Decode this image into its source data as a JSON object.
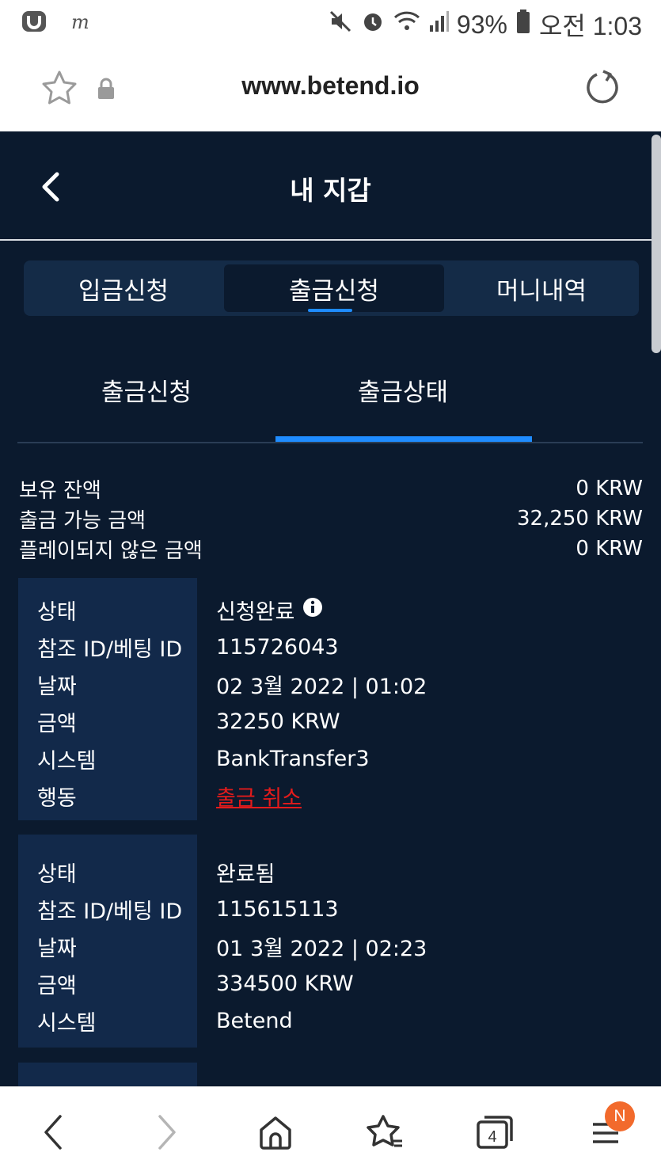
{
  "statusbar": {
    "battery": "93%",
    "time": "오전 1:03"
  },
  "browser": {
    "url": "www.betend.io"
  },
  "header": {
    "title": "내 지갑"
  },
  "tabs": [
    "입금신청",
    "출금신청",
    "머니내역"
  ],
  "subtabs": [
    "출금신청",
    "출금상태"
  ],
  "balance": [
    {
      "label": "보유 잔액",
      "value": "0 KRW"
    },
    {
      "label": "출금 가능 금액",
      "value": "32,250 KRW"
    },
    {
      "label": "플레이되지 않은 금액",
      "value": "0 KRW"
    }
  ],
  "records": [
    {
      "labels": [
        "상태",
        "참조 ID/베팅 ID",
        "날짜",
        "금액",
        "시스템",
        "행동"
      ],
      "status": "신청완료",
      "ref_id": "115726043",
      "date": "02 3월 2022 | 01:02",
      "amount": "32250 KRW",
      "system": "BankTransfer3",
      "action": "출금 취소"
    },
    {
      "labels": [
        "상태",
        "참조 ID/베팅 ID",
        "날짜",
        "금액",
        "시스템"
      ],
      "status": "완료됨",
      "ref_id": "115615113",
      "date": "01 3월 2022 | 02:23",
      "amount": "334500 KRW",
      "system": "Betend"
    }
  ],
  "bottomnav": {
    "tabs_count": "4",
    "menu_badge": "N"
  }
}
